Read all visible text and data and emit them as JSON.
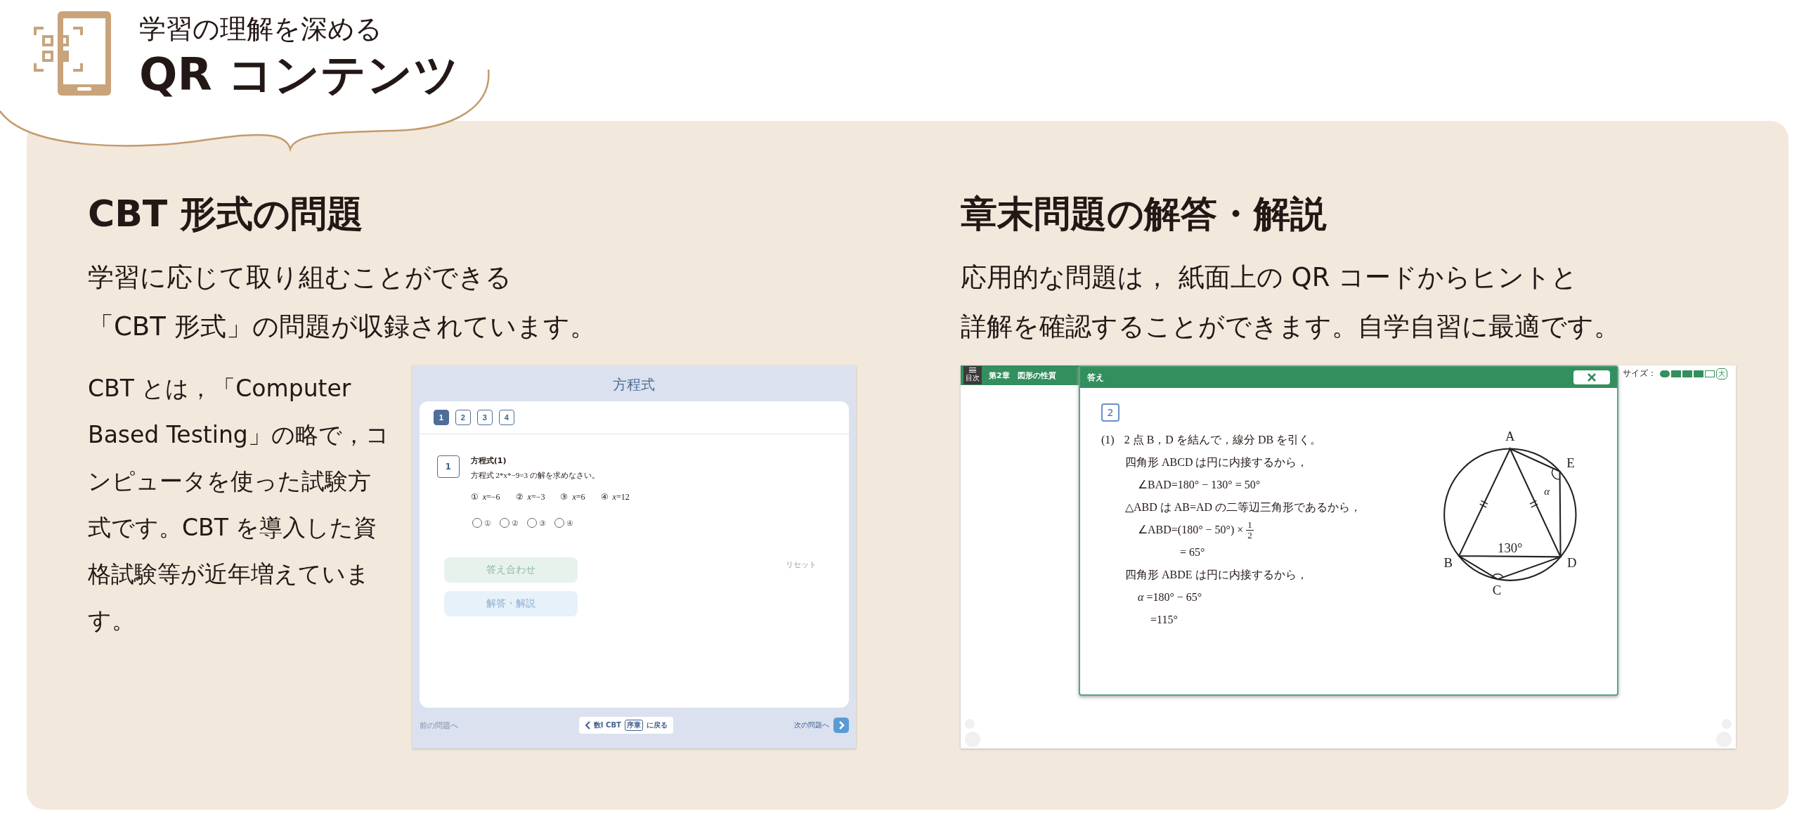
{
  "header": {
    "subtitle": "学習の理解を深める",
    "title": "QR コンテンツ"
  },
  "cbt_section": {
    "title": "CBT 形式の問題",
    "description_lines": [
      "学習に応じて取り組むことができる",
      "「CBT 形式」の問題が収録されています。"
    ],
    "note": "CBT とは，「Computer Based Testing」の略で，コンピュータを使った試験方式です。CBT を導入した資格試験等が近年増えています。",
    "app": {
      "title": "方程式",
      "question_tabs": [
        {
          "label": "1",
          "selected": true
        },
        {
          "label": "2",
          "selected": false
        },
        {
          "label": "3",
          "selected": false
        },
        {
          "label": "4",
          "selected": false
        }
      ],
      "question": {
        "number": "1",
        "heading": "方程式(1)",
        "text": "方程式 2*x*−9=3 の解を求めなさい。"
      },
      "choices": [
        {
          "mark": "①",
          "answer": "*x*=−6"
        },
        {
          "mark": "②",
          "answer": "*x*=−3"
        },
        {
          "mark": "③",
          "answer": "*x*=6"
        },
        {
          "mark": "④",
          "answer": "*x*=12"
        }
      ],
      "radio_options": [
        {
          "label": "①",
          "selected": false
        },
        {
          "label": "②",
          "selected": false
        },
        {
          "label": "③",
          "selected": false
        },
        {
          "label": "④",
          "selected": false
        }
      ],
      "check_button": {
        "label": "答え合わせ",
        "disabled": true
      },
      "solution_button": {
        "label": "解答・解説",
        "disabled": true
      },
      "reset_button": {
        "label": "リセット",
        "disabled": true
      },
      "prev_button": {
        "label": "前の問題へ",
        "disabled": true
      },
      "back_link": {
        "prefix": "数Ⅰ CBT",
        "chapter": "序章",
        "suffix": "に戻る"
      },
      "next_button": {
        "label": "次の問題へ",
        "disabled": false
      }
    }
  },
  "answer_section": {
    "title": "章末問題の解答・解説",
    "description_lines": [
      "応用的な問題は， 紙面上の QR コードからヒントと",
      "詳解を確認することができます。自学自習に最適です。"
    ],
    "app": {
      "menu_label": "目次",
      "chapter": "第2章　図形の性質",
      "size_label": "サイズ：",
      "size_steps": [
        {
          "filled": true
        },
        {
          "filled": true
        },
        {
          "filled": true
        },
        {
          "filled": false
        }
      ],
      "size_max_label": "大",
      "dialog": {
        "title": "答え",
        "problem_number": "2",
        "lines": [
          {
            "kind": "item",
            "label": "(1)",
            "text": "2 点 B，D を結んで，線分 DB を引く。"
          },
          {
            "kind": "reason",
            "text": "四角形 ABCD は円に内接するから，"
          },
          {
            "kind": "calc",
            "text": "∠BAD=180° − 130° = 50°"
          },
          {
            "kind": "reason",
            "text": "△ABD は AB=AD の二等辺三角形であるから，"
          },
          {
            "kind": "fraction",
            "text": "∠ABD=(180° − 50°) ×",
            "numerator": "1",
            "denominator": "2"
          },
          {
            "kind": "continued",
            "text": "= 65°"
          },
          {
            "kind": "reason",
            "text": "四角形 ABDE は円に内接するから，"
          },
          {
            "kind": "calc",
            "text": "*α* =180° − 65°"
          },
          {
            "kind": "result",
            "text": "=115°"
          }
        ],
        "figure": {
          "vertices": [
            "A",
            "B",
            "C",
            "D",
            "E"
          ],
          "angle_label": "130°",
          "angle_symbol": "α"
        }
      }
    }
  }
}
